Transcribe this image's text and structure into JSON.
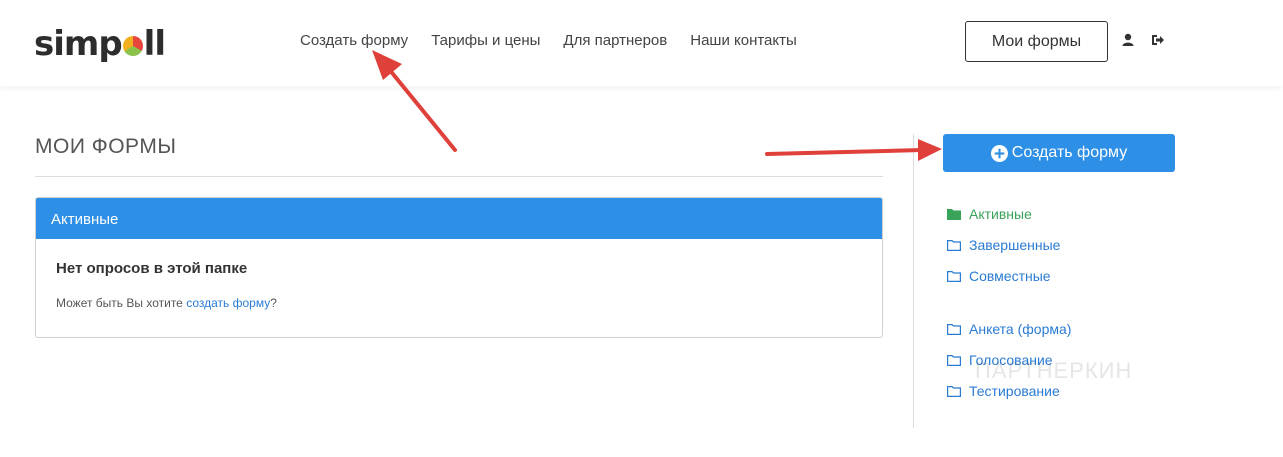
{
  "logo": {
    "text_before": "simp",
    "text_after": "ll"
  },
  "nav": {
    "items": [
      {
        "label": "Создать форму"
      },
      {
        "label": "Тарифы и цены"
      },
      {
        "label": "Для партнеров"
      },
      {
        "label": "Наши контакты"
      }
    ]
  },
  "header": {
    "my_forms_label": "Мои формы",
    "icons": [
      "user-icon",
      "sign-out-icon"
    ]
  },
  "main": {
    "title": "МОИ ФОРМЫ",
    "panel": {
      "heading": "Активные",
      "empty_title": "Нет опросов в этой папке",
      "empty_text_prefix": "Может быть Вы хотите ",
      "empty_text_link": "создать форму",
      "empty_text_suffix": "?"
    }
  },
  "sidebar": {
    "create_label": "Создать форму",
    "folders": [
      {
        "label": "Активные",
        "icon": "folder-filled-icon",
        "active": true
      },
      {
        "label": "Завершенные",
        "icon": "folder-open-icon"
      },
      {
        "label": "Совместные",
        "icon": "folder-open-icon"
      }
    ],
    "types": [
      {
        "label": "Анкета (форма)",
        "icon": "folder-open-icon"
      },
      {
        "label": "Голосование",
        "icon": "folder-open-icon"
      },
      {
        "label": "Тестирование",
        "icon": "folder-open-icon"
      }
    ]
  },
  "watermark": "ПАРТНЕРКИН",
  "colors": {
    "accent": "#2e8fe6",
    "link": "#2a7bd4",
    "active_folder": "#3aa35a",
    "annotation_arrow": "#e0403a"
  }
}
